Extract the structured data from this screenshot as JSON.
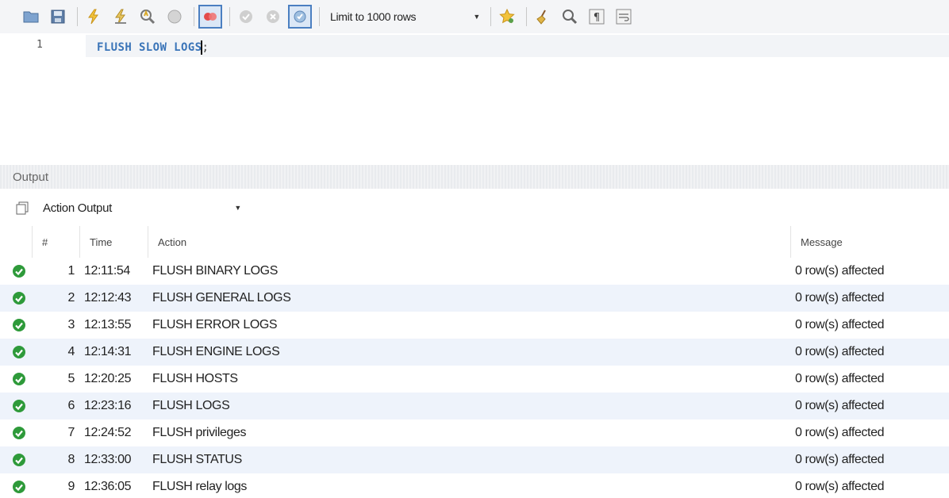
{
  "toolbar": {
    "limit_label": "Limit to 1000 rows",
    "buttons": [
      "open-folder-icon",
      "save-icon",
      "execute-icon",
      "execute-current-icon",
      "explain-icon",
      "stop-icon",
      "toggle-continue-icon",
      "commit-icon",
      "rollback-icon",
      "autocommit-icon",
      "limit-dropdown",
      "bookmark-icon",
      "beautify-icon",
      "find-icon",
      "invisible-chars-icon",
      "word-wrap-icon"
    ]
  },
  "editor": {
    "line_number": "1",
    "code_before_caret": "FLUSH SLOW LOGS",
    "code_after_caret": ";"
  },
  "output": {
    "title": "Output",
    "selector_label": "Action Output",
    "columns": {
      "num": "#",
      "time": "Time",
      "action": "Action",
      "message": "Message"
    },
    "rows": [
      {
        "num": "1",
        "time": "12:11:54",
        "action": "FLUSH BINARY LOGS",
        "message": "0 row(s) affected",
        "status": "success"
      },
      {
        "num": "2",
        "time": "12:12:43",
        "action": "FLUSH GENERAL LOGS",
        "message": "0 row(s) affected",
        "status": "success"
      },
      {
        "num": "3",
        "time": "12:13:55",
        "action": "FLUSH ERROR LOGS",
        "message": "0 row(s) affected",
        "status": "success"
      },
      {
        "num": "4",
        "time": "12:14:31",
        "action": "FLUSH ENGINE LOGS",
        "message": "0 row(s) affected",
        "status": "success"
      },
      {
        "num": "5",
        "time": "12:20:25",
        "action": "FLUSH HOSTS",
        "message": "0 row(s) affected",
        "status": "success"
      },
      {
        "num": "6",
        "time": "12:23:16",
        "action": "FLUSH LOGS",
        "message": "0 row(s) affected",
        "status": "success"
      },
      {
        "num": "7",
        "time": "12:24:52",
        "action": "FLUSH privileges",
        "message": "0 row(s) affected",
        "status": "success"
      },
      {
        "num": "8",
        "time": "12:33:00",
        "action": "FLUSH STATUS",
        "message": "0 row(s) affected",
        "status": "success"
      },
      {
        "num": "9",
        "time": "12:36:05",
        "action": "FLUSH relay logs",
        "message": "0 row(s) affected",
        "status": "success"
      }
    ]
  },
  "colors": {
    "keyword": "#3a74b8",
    "success": "#2e9a3a",
    "alt_row": "#eef3fb",
    "accent": "#4b7fc1"
  }
}
